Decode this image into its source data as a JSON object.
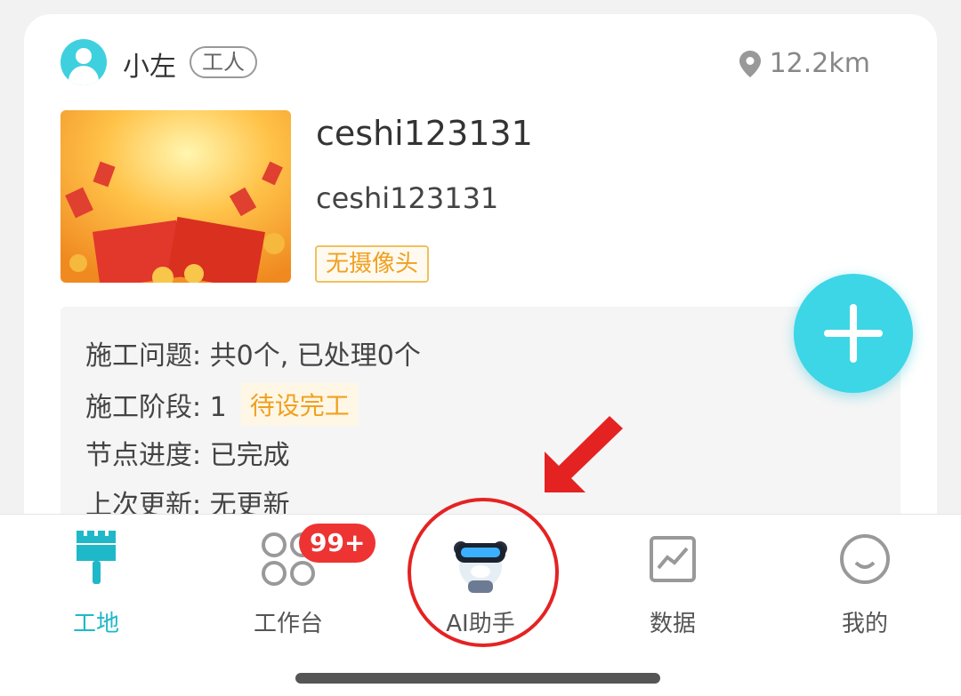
{
  "card": {
    "user_name": "小左",
    "role": "工人",
    "distance": "12.2km",
    "title_main": "ceshi123131",
    "title_sub": "ceshi123131",
    "camera_tag": "无摄像头",
    "info": {
      "line1": "施工问题: 共0个, 已处理0个",
      "line2_prefix": "施工阶段: 1",
      "line2_tag": "待设完工",
      "line3": "节点进度: 已完成",
      "line4": "上次更新: 无更新"
    }
  },
  "fab": {
    "icon": "plus-icon"
  },
  "tabbar": {
    "tabs": [
      {
        "label": "工地",
        "icon": "brush-icon",
        "active": true
      },
      {
        "label": "工作台",
        "icon": "grid-icon",
        "badge": "99+"
      },
      {
        "label": "AI助手",
        "icon": "robot-avatar-icon"
      },
      {
        "label": "数据",
        "icon": "chart-icon"
      },
      {
        "label": "我的",
        "icon": "smile-icon"
      }
    ]
  },
  "colors": {
    "accent": "#1fb8c9",
    "fab": "#3dd6e6",
    "badge": "#ee3333",
    "annotation": "#e52222",
    "tag": "#f0a020"
  }
}
